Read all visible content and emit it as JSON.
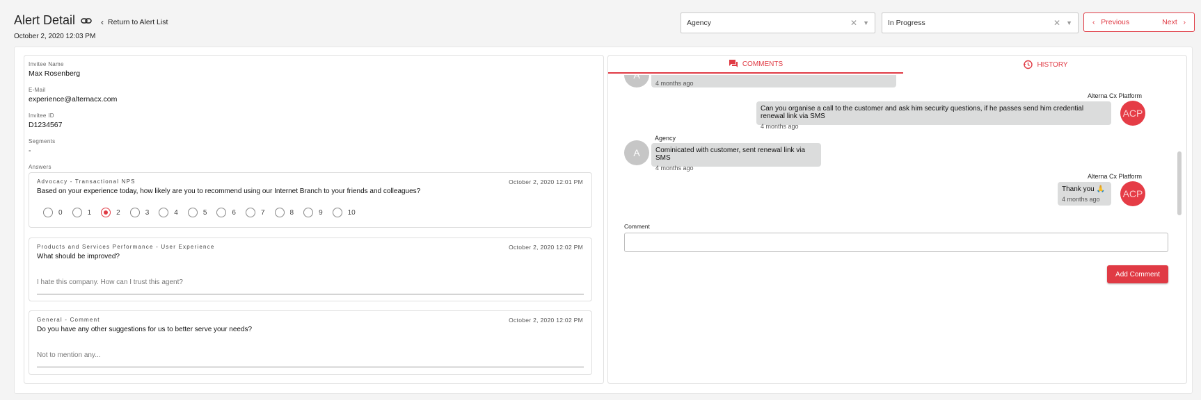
{
  "header": {
    "title": "Alert Detail",
    "back_label": "Return to Alert List",
    "date": "October 2, 2020 12:03 PM",
    "agency_select": "Agency",
    "status_select": "In Progress",
    "previous_label": "Previous",
    "next_label": "Next"
  },
  "details": {
    "invitee_name_label": "Invitee Name",
    "invitee_name": "Max Rosenberg",
    "email_label": "E-Mail",
    "email": "experience@alternacx.com",
    "invitee_id_label": "Invitee ID",
    "invitee_id": "D1234567",
    "segments_label": "Segments",
    "segments": "-",
    "answers_label": "Answers"
  },
  "answers": [
    {
      "category": "Advocacy - Transactional NPS",
      "time": "October 2, 2020 12:01 PM",
      "question": "Based on your experience today, how likely are you to recommend using our Internet Branch to your friends and colleagues?",
      "scale": [
        "0",
        "1",
        "2",
        "3",
        "4",
        "5",
        "6",
        "7",
        "8",
        "9",
        "10"
      ],
      "selected": 2
    },
    {
      "category": "Products and Services Performance - User Experience",
      "time": "October 2, 2020 12:02 PM",
      "question": "What should be improved?",
      "answer": "I hate this company.  How can I trust this agent?"
    },
    {
      "category": "General - Comment",
      "time": "October 2, 2020 12:02 PM",
      "question": "Do you have any other suggestions for us to better serve your needs?",
      "answer": "Not to mention any..."
    }
  ],
  "tabs": {
    "comments": "COMMENTS",
    "history": "HISTORY"
  },
  "comments": [
    {
      "sender": "",
      "avatar": "A",
      "text": "",
      "time": "4 months ago"
    },
    {
      "sender": "Alterna Cx Platform",
      "avatar": "ACP",
      "text": "Can you organise a call to the customer and ask him security questions, if he passes send him credential renewal link via SMS",
      "time": "4 months ago"
    },
    {
      "sender": "Agency",
      "avatar": "A",
      "text": "Cominicated with customer, sent renewal link via SMS",
      "time": "4 months ago"
    },
    {
      "sender": "Alterna Cx Platform",
      "avatar": "ACP",
      "text": "Thank you 🙏",
      "time": "4 months ago"
    }
  ],
  "comment_form": {
    "label": "Comment",
    "value": "",
    "button": "Add Comment"
  },
  "colors": {
    "accent": "#e03a44",
    "bubble": "#dbdcdc"
  }
}
